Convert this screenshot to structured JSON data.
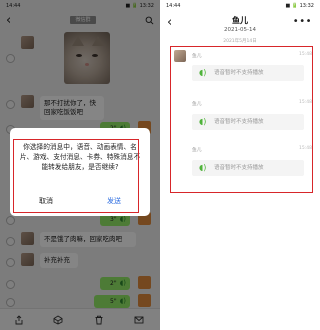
{
  "left": {
    "status_time": "14:44",
    "status_right": "■ 🔋 13:32",
    "title_chip": "微信群",
    "messages": {
      "text1": "那不打扰你了，快回家吃饭饭吧",
      "voice1_duration": "2\"",
      "voice2_duration": "3\"",
      "text2": "不是饿了肉嘛，回家吃肉吧",
      "text3": "补充补充",
      "voice3_duration": "2\"",
      "voice4_duration": "5\""
    },
    "dialog": {
      "message": "你选择的消息中，语音、动画表情、名片、游戏、支付消息、卡券、特殊消息不能转发给朋友，是否继续?",
      "cancel_label": "取消",
      "send_label": "发送"
    }
  },
  "right": {
    "status_time": "14:44",
    "status_right": "■ 🔋 13:32",
    "contact_name": "鱼儿",
    "date": "2021-05-14",
    "subdate": "2021年5月14日",
    "more_label": "•••",
    "records": [
      {
        "sender": "鱼儿",
        "time": "15:48",
        "text": "语音暂时不支持播放"
      },
      {
        "sender": "鱼儿",
        "time": "15:48",
        "text": "语音暂时不支持播放"
      },
      {
        "sender": "鱼儿",
        "time": "15:48",
        "text": "语音暂时不支持播放"
      }
    ]
  },
  "colors": {
    "highlight_red": "#d7262a",
    "send_blue": "#2a6be0",
    "voice_green": "#4fb33a",
    "bubble_green": "#95ec69"
  },
  "icons": [
    "back-arrow-icon",
    "search-icon",
    "share-icon",
    "favorite-icon",
    "delete-icon",
    "mail-icon",
    "more-icon",
    "voice-wave-icon"
  ]
}
